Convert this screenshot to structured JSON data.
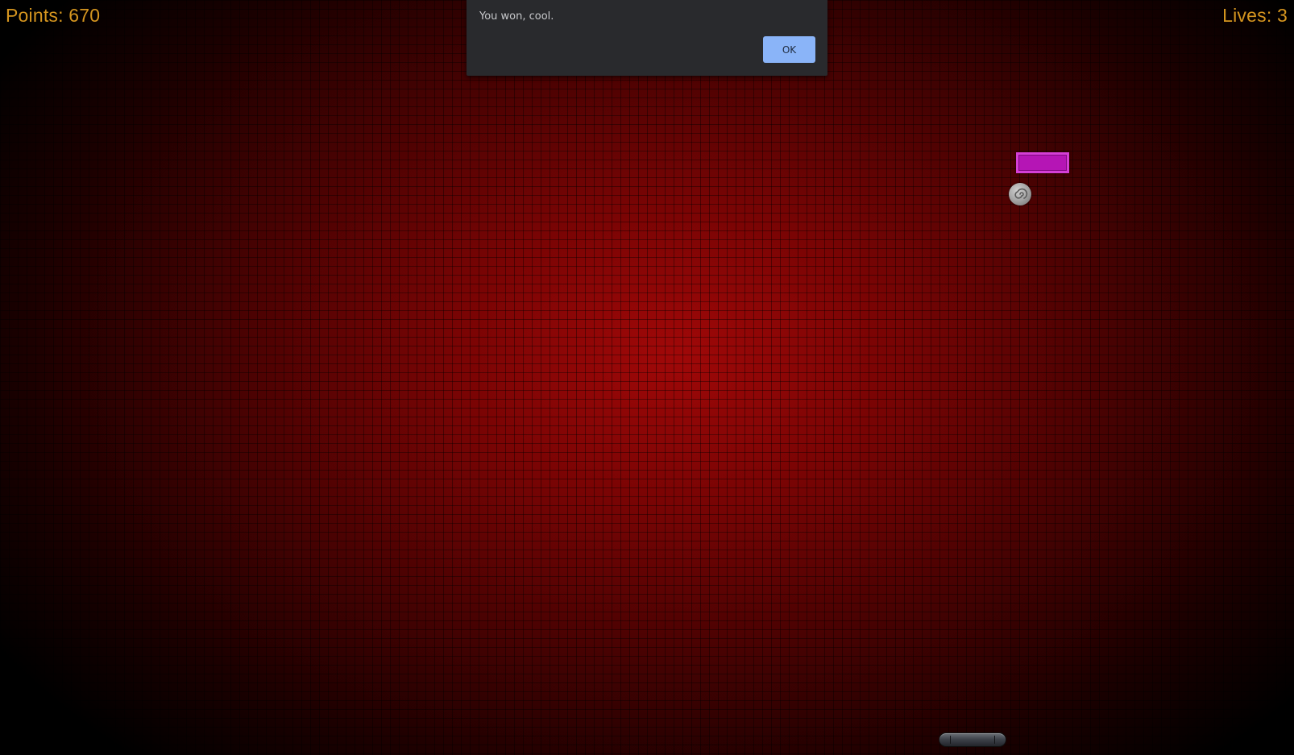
{
  "hud": {
    "points_text": "Points: 670",
    "lives_text": "Lives: 3"
  },
  "dialog": {
    "message": "You won, cool.",
    "ok_label": "OK"
  },
  "colors": {
    "hud_text": "#d5951f",
    "background": "#8e0707",
    "brick": "#b515b5",
    "dialog_bg": "#292a2d",
    "dialog_button": "#8ab4f8"
  },
  "icons": {
    "ball": "swirl-ball-icon"
  }
}
